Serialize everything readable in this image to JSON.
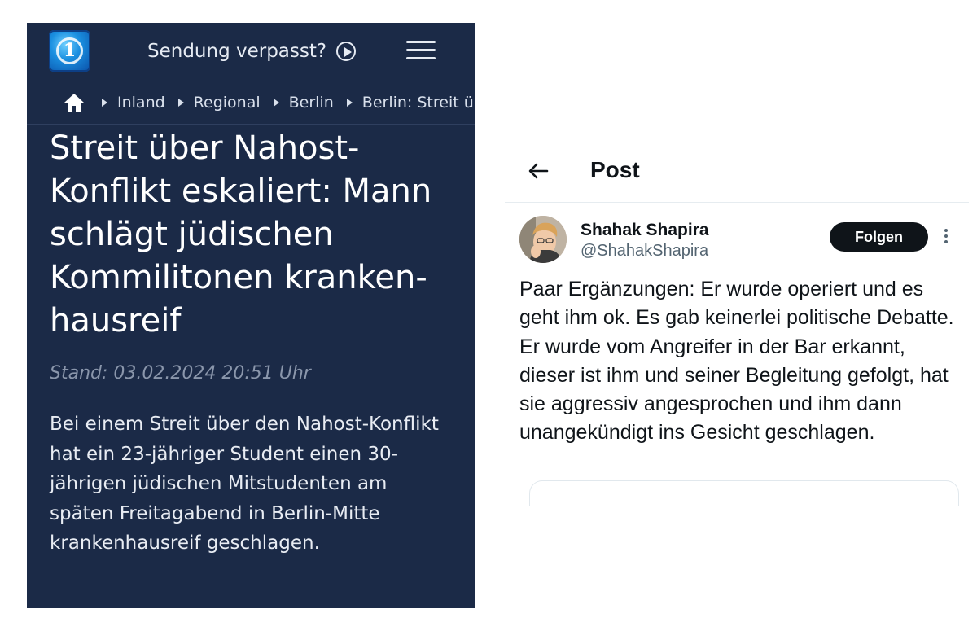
{
  "tagesschau": {
    "header": {
      "logo_icon": "tagesschau-logo",
      "missed_show_label": "Sendung verpasst?",
      "play_icon": "play-circle-icon",
      "menu_icon": "hamburger-menu-icon"
    },
    "breadcrumb": {
      "home_icon": "home-icon",
      "items": [
        "Inland",
        "Regional",
        "Berlin",
        "Berlin: Streit ü"
      ]
    },
    "article": {
      "title": "Streit über Nahost-Konflikt eskaliert: Mann schlägt jüdischen Kommilitonen kranken­hausreif",
      "date": "Stand: 03.02.2024 20:51 Uhr",
      "lead": "Bei einem Streit über den Nahost-Konflikt hat ein 23-jähriger Student einen 30-jährigen jüdischen Mitstudenten am späten Freitagabend in Berlin-Mitte krankenhausreif geschlagen."
    },
    "colors": {
      "background": "#1b2a47",
      "text": "#ffffff",
      "date": "#8a96ab"
    }
  },
  "x_post": {
    "header": {
      "back_icon": "arrow-left-icon",
      "title": "Post"
    },
    "author": {
      "display_name": "Shahak Shapira",
      "handle": "@ShahakShapira",
      "avatar": "profile-photo"
    },
    "follow_label": "Folgen",
    "more_icon": "more-vertical-icon",
    "text": "Paar Ergänzungen: Er wurde operiert und es geht ihm ok. Es gab keinerlei politische Debatte. Er wurde vom Angreifer in der Bar erkannt, dieser ist ihm und seiner Begleitung gefolgt, hat sie aggressiv angesprochen und ihm dann unangekündigt ins Gesicht geschlagen.",
    "colors": {
      "text": "#0f1419",
      "secondary": "#536471",
      "button": "#0f1419"
    }
  }
}
